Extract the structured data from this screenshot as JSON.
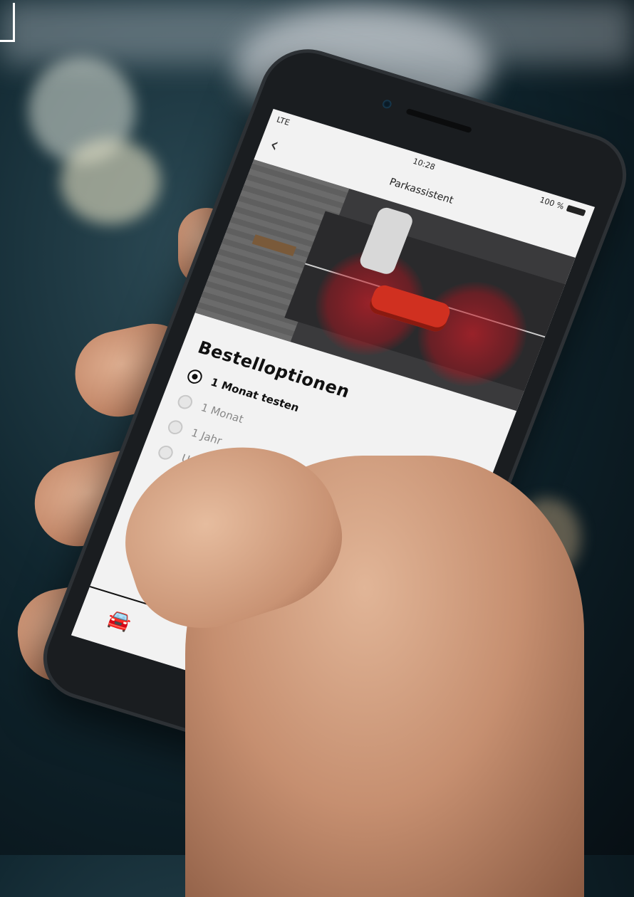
{
  "status_bar": {
    "signal": "LTE",
    "time": "10:28",
    "battery": "100 %"
  },
  "nav": {
    "back_icon": "‹",
    "title": "Parkassistent"
  },
  "section": {
    "title": "Bestelloptionen"
  },
  "options": [
    {
      "label": "1 Monat testen",
      "selected": true
    },
    {
      "label": "1 Monat",
      "selected": false
    },
    {
      "label": "1 Jahr",
      "selected": false
    },
    {
      "label": "Unbegrenzt",
      "selected": false
    }
  ],
  "tabbar": {
    "car_icon": "🚘"
  },
  "colors": {
    "accent": "#d03020",
    "screen_bg": "#f2f2f2",
    "text": "#111111"
  }
}
